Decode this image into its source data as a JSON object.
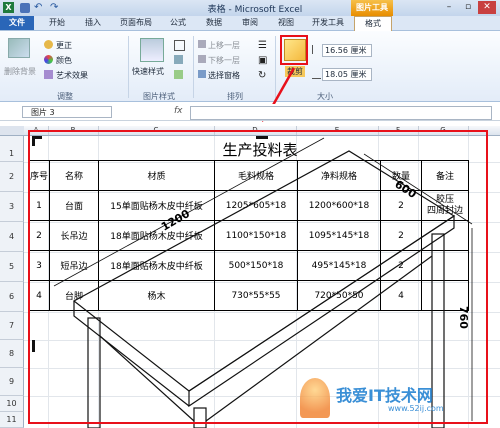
{
  "window": {
    "title": "表格 - Microsoft Excel",
    "context_tab": "图片工具"
  },
  "tabs": [
    "文件",
    "开始",
    "插入",
    "页面布局",
    "公式",
    "数据",
    "审阅",
    "视图",
    "开发工具",
    "格式"
  ],
  "ribbon": {
    "adjust": {
      "remove_bg": "删除背景",
      "corrections": "更正",
      "color": "颜色",
      "artistic": "艺术效果",
      "label": "调整"
    },
    "styles": {
      "quick": "快速样式",
      "label": "图片样式"
    },
    "arrange": {
      "forward": "上移一层",
      "backward": "下移一层",
      "pane": "选择窗格",
      "label": "排列"
    },
    "size": {
      "crop": "裁剪",
      "height": "16.56 厘米",
      "width": "18.05 厘米",
      "label": "大小"
    }
  },
  "formula_bar": {
    "name_box": "图片 3",
    "fx": "fx"
  },
  "columns": [
    "A",
    "B",
    "C",
    "D",
    "E",
    "F",
    "G"
  ],
  "rows": [
    "1",
    "2",
    "3",
    "4",
    "5",
    "6",
    "7",
    "8",
    "9",
    "10",
    "11"
  ],
  "sheet": {
    "title": "生产投料表",
    "headers": [
      "序号",
      "名称",
      "材质",
      "毛料规格",
      "净料规格",
      "数量",
      "备注"
    ],
    "rows": [
      [
        "1",
        "台面",
        "15单面贴杨木皮中纤板",
        "1205*605*18",
        "1200*600*18",
        "2",
        "胶压\n四周封边"
      ],
      [
        "2",
        "长吊边",
        "18单面贴杨木皮中纤板",
        "1100*150*18",
        "1095*145*18",
        "2",
        ""
      ],
      [
        "3",
        "短吊边",
        "18单面贴杨木皮中纤板",
        "500*150*18",
        "495*145*18",
        "2",
        ""
      ],
      [
        "4",
        "台脚",
        "杨木",
        "730*55*55",
        "720*50*50",
        "4",
        ""
      ]
    ]
  },
  "drawing": {
    "dim_top": "600",
    "dim_side": "1200",
    "dim_height": "760"
  },
  "watermark": {
    "text": "我爱IT技术网",
    "url": "www.52ij.com"
  },
  "colors": {
    "highlight": "#e8101a",
    "file_tab": "#2a66b8",
    "context": "#e88d00"
  }
}
